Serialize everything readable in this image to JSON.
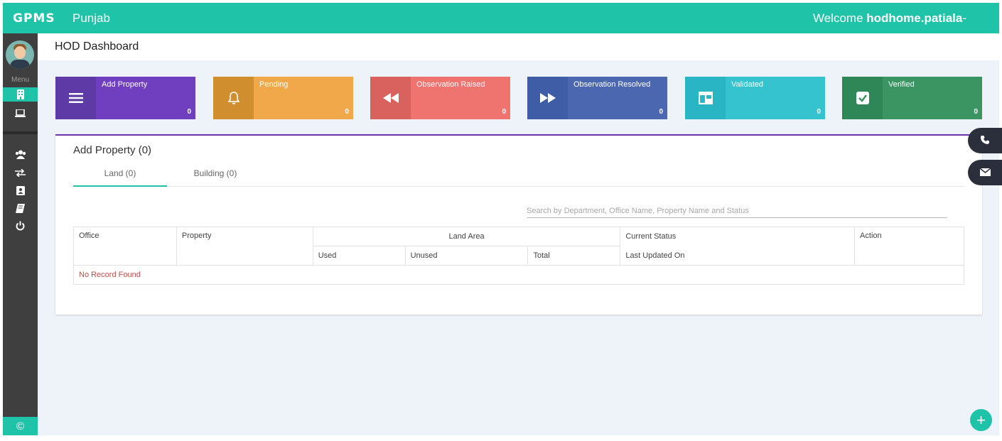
{
  "header": {
    "logo": "GPMS",
    "state": "Punjab",
    "welcome_prefix": "Welcome ",
    "username": "hodhome.patiala",
    "caret": "-"
  },
  "sidebar": {
    "menu_label": "Menu",
    "icons": [
      "building-icon",
      "laptop-icon",
      "users-icon",
      "exchange-icon",
      "contact-icon",
      "book-icon",
      "power-icon"
    ],
    "copyright_symbol": "©"
  },
  "page": {
    "title": "HOD Dashboard"
  },
  "tiles": [
    {
      "label": "Add Property",
      "count": "0",
      "icon": "menu-icon",
      "icon_bg": "#5d3aa6",
      "bg": "#6f3fbf"
    },
    {
      "label": "Pending",
      "count": "0",
      "icon": "bell-icon",
      "icon_bg": "#d08e2e",
      "bg": "#f0a84a"
    },
    {
      "label": "Observation Raised",
      "count": "0",
      "icon": "backward-icon",
      "icon_bg": "#d9625e",
      "bg": "#ef7470"
    },
    {
      "label": "Observation Resolved",
      "count": "0",
      "icon": "forward-icon",
      "icon_bg": "#3f5da6",
      "bg": "#4b67b0"
    },
    {
      "label": "Validated",
      "count": "0",
      "icon": "columns-icon",
      "icon_bg": "#29b5c3",
      "bg": "#35c3d0"
    },
    {
      "label": "Verified",
      "count": "0",
      "icon": "check-square-icon",
      "icon_bg": "#2f8657",
      "bg": "#3a9563"
    }
  ],
  "card": {
    "title": "Add Property (0)",
    "tabs": [
      {
        "label": "Land (0)",
        "active": true
      },
      {
        "label": "Building (0)",
        "active": false
      }
    ],
    "search_placeholder": "Search by Department, Office Name, Property Name and Status",
    "table": {
      "headers": {
        "office": "Office",
        "property": "Property",
        "land_area": "Land Area",
        "used": "Used",
        "unused": "Unused",
        "total": "Total",
        "current_status": "Current Status",
        "last_updated": "Last Updated On",
        "action": "Action"
      },
      "empty_message": "No Record Found"
    }
  },
  "floating": {
    "phone_icon": "phone-icon",
    "mail_icon": "envelope-icon",
    "fab_label": "+"
  },
  "colors": {
    "accent": "#1fc3a7",
    "sidebar": "#3e3f3e",
    "card_border": "#6b35b0"
  }
}
